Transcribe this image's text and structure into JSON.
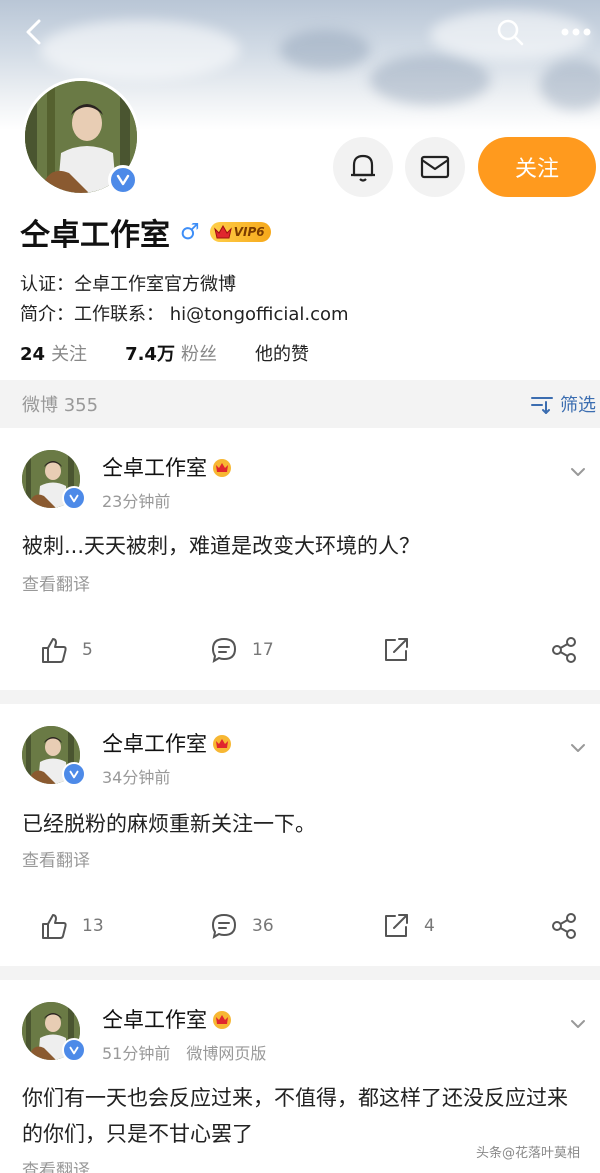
{
  "profile": {
    "name": "仝卓工作室",
    "vip_label": "VIP6",
    "follow_label": "关注",
    "cert_label": "认证：",
    "cert_value": "仝卓工作室官方微博",
    "bio_label": "简介：",
    "bio_value": "工作联系：  hi@tongofficial.com",
    "stats": {
      "following_count": "24",
      "following_label": "关注",
      "followers_count": "7.4万",
      "followers_label": "粉丝",
      "likes_label": "他的赞"
    }
  },
  "feed": {
    "count_label": "微博 355",
    "filter_label": "筛选"
  },
  "posts": [
    {
      "author": "仝卓工作室",
      "time": "23分钟前",
      "source": "",
      "text": "被刺...天天被刺，难道是改变大环境的人？",
      "translate": "查看翻译",
      "likes": "5",
      "comments": "17",
      "reposts": ""
    },
    {
      "author": "仝卓工作室",
      "time": "34分钟前",
      "source": "",
      "text": "已经脱粉的麻烦重新关注一下。",
      "translate": "查看翻译",
      "likes": "13",
      "comments": "36",
      "reposts": "4"
    },
    {
      "author": "仝卓工作室",
      "time": "51分钟前",
      "source": "微博网页版",
      "text": "你们有一天也会反应过来，不值得，都这样了还没反应过来的你们，只是不甘心罢了",
      "translate": "查看翻译"
    }
  ],
  "watermark": "头条@花落叶莫相"
}
